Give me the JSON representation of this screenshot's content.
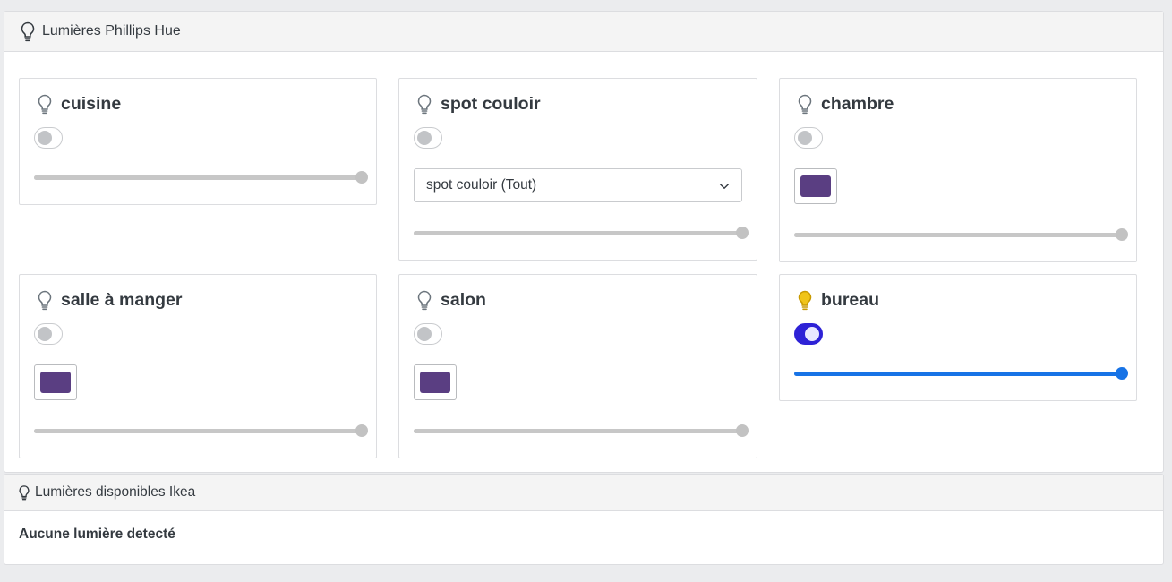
{
  "hue_panel": {
    "title": "Lumières Phillips Hue",
    "icon": "lightbulb-outline-icon"
  },
  "lights": [
    {
      "name": "cuisine",
      "on": false,
      "brightness": 1.0,
      "has_color": false,
      "group_select": null
    },
    {
      "name": "spot couloir",
      "on": false,
      "brightness": 1.0,
      "has_color": false,
      "group_select": "spot couloir (Tout)"
    },
    {
      "name": "chambre",
      "on": false,
      "brightness": 1.0,
      "has_color": true,
      "color": "#5a3e82",
      "group_select": null
    },
    {
      "name": "salle à manger",
      "on": false,
      "brightness": 1.0,
      "has_color": true,
      "color": "#5a3e82",
      "group_select": null
    },
    {
      "name": "salon",
      "on": false,
      "brightness": 1.0,
      "has_color": true,
      "color": "#5a3e82",
      "group_select": null
    },
    {
      "name": "bureau",
      "on": true,
      "brightness": 1.0,
      "has_color": false,
      "group_select": null
    }
  ],
  "ikea_panel": {
    "title": "Lumières disponibles Ikea",
    "icon": "lightbulb-outline-icon",
    "empty_message": "Aucune lumière detecté"
  },
  "colors": {
    "bulb_off": "#6c757d",
    "bulb_on": "#f0c419",
    "toggle_on": "#2e22d6",
    "slider_active": "#1773e6"
  }
}
